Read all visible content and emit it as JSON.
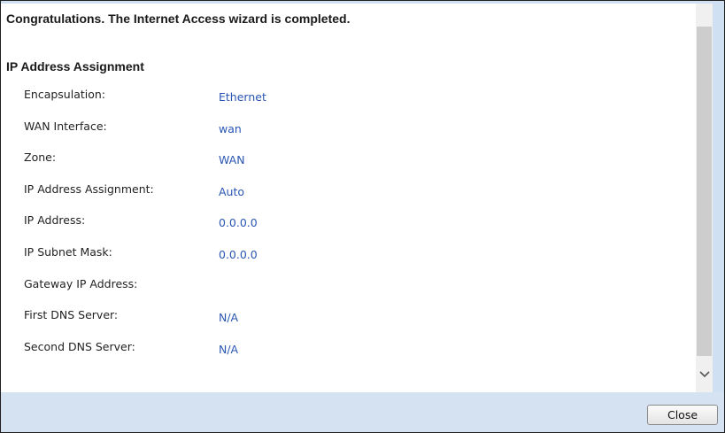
{
  "wizard": {
    "completion_message": "Congratulations. The Internet Access wizard is completed.",
    "section_title": "IP Address Assignment",
    "fields": [
      {
        "label": "Encapsulation:",
        "value": "Ethernet"
      },
      {
        "label": "WAN Interface:",
        "value": "wan"
      },
      {
        "label": "Zone:",
        "value": "WAN"
      },
      {
        "label": "IP Address Assignment:",
        "value": "Auto"
      },
      {
        "label": "IP Address:",
        "value": "0.0.0.0"
      },
      {
        "label": "IP Subnet Mask:",
        "value": "0.0.0.0"
      },
      {
        "label": "Gateway IP Address:",
        "value": ""
      },
      {
        "label": "First DNS Server:",
        "value": "N/A"
      },
      {
        "label": "Second DNS Server:",
        "value": "N/A"
      }
    ]
  },
  "footer": {
    "close_label": "Close"
  },
  "scrollbar": {
    "down_icon": "chevron-down-icon"
  },
  "colors": {
    "value_text": "#2a56b3",
    "footer_bg": "#d4e2f1",
    "accent_strip": "#cfe0f3"
  }
}
